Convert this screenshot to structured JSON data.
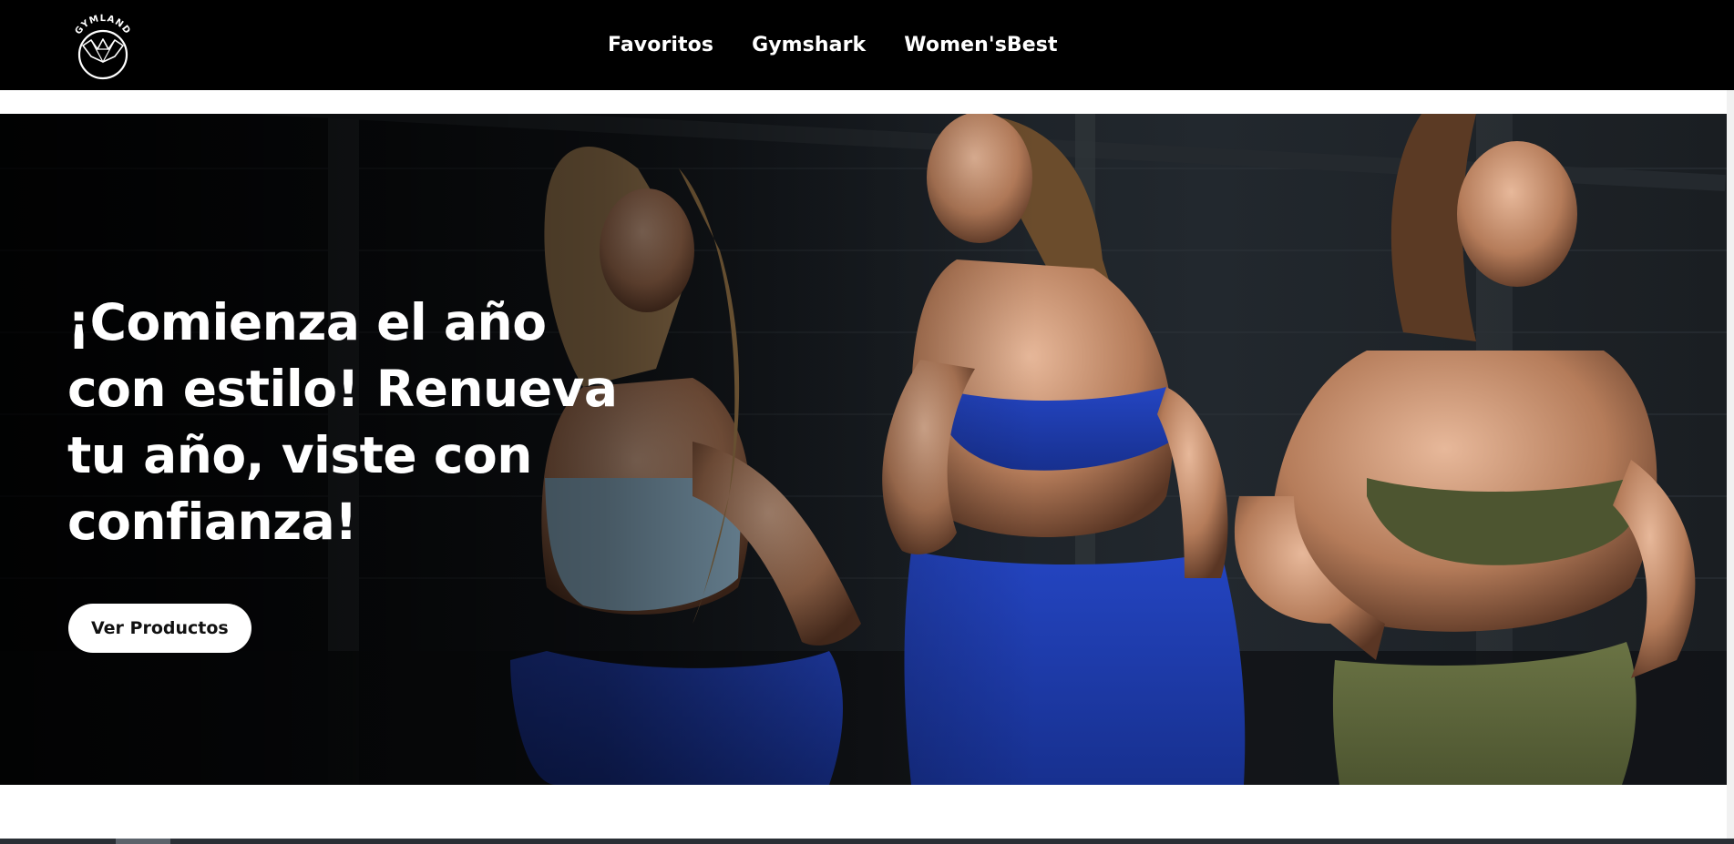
{
  "header": {
    "logo_text": "GYMLAND",
    "nav": [
      {
        "label": "Favoritos"
      },
      {
        "label": "Gymshark"
      },
      {
        "label": "Women'sBest"
      }
    ]
  },
  "hero": {
    "title": "¡Comienza el año con estilo! Renueva tu año, viste con confianza!",
    "cta_label": "Ver Productos"
  },
  "colors": {
    "header_bg": "#000000",
    "cta_bg": "#ffffff",
    "legging_blue": "#1f3fb0",
    "bra_light_blue": "#9cc3dc",
    "olive": "#5d6636"
  },
  "icons": [
    "gymland-logo",
    "brand-heart-icon"
  ]
}
